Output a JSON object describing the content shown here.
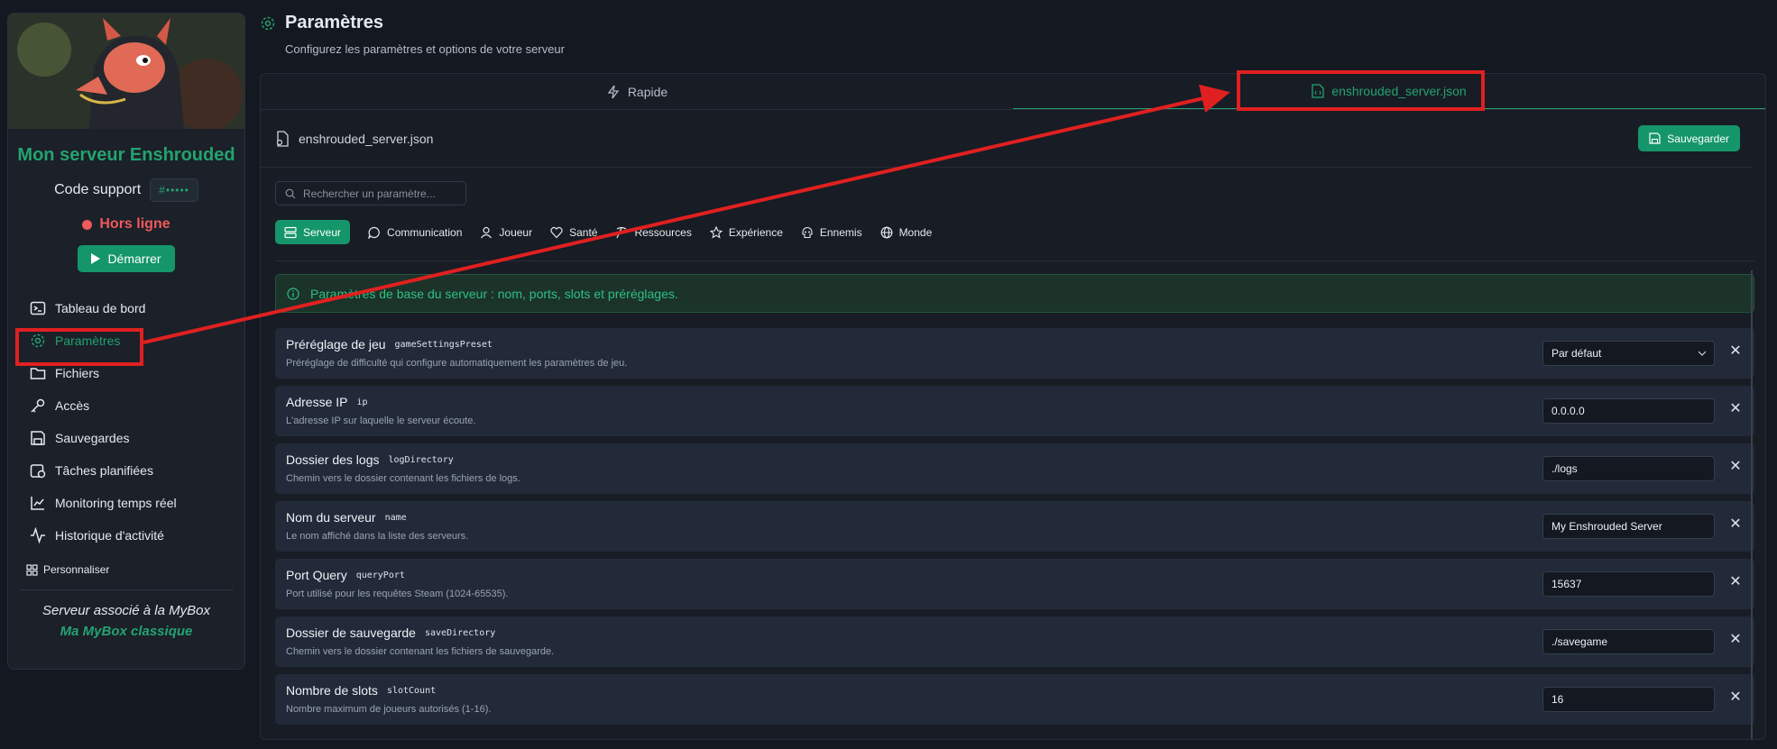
{
  "sidebar": {
    "server_name": "Mon serveur Enshrouded",
    "support_label": "Code support",
    "support_code": "#•••••",
    "status": "Hors ligne",
    "start_label": "Démarrer",
    "nav": [
      {
        "label": "Tableau de bord",
        "icon": "terminal-icon"
      },
      {
        "label": "Paramètres",
        "icon": "gear-icon",
        "active": true
      },
      {
        "label": "Fichiers",
        "icon": "folder-icon"
      },
      {
        "label": "Accès",
        "icon": "key-icon"
      },
      {
        "label": "Sauvegardes",
        "icon": "floppy-icon"
      },
      {
        "label": "Tâches planifiées",
        "icon": "calendar-clock-icon"
      },
      {
        "label": "Monitoring temps réel",
        "icon": "chart-line-icon"
      },
      {
        "label": "Historique d'activité",
        "icon": "activity-icon"
      }
    ],
    "personalize_label": "Personnaliser",
    "mybox_label": "Serveur associé à la MyBox",
    "mybox_name": "Ma MyBox classique"
  },
  "header": {
    "title": "Paramètres",
    "subtitle": "Configurez les paramètres et options de votre serveur"
  },
  "tabs": [
    {
      "label": "Rapide",
      "icon": "zap-icon"
    },
    {
      "label": "enshrouded_server.json",
      "icon": "file-code-icon",
      "active": true
    }
  ],
  "file": {
    "name": "enshrouded_server.json",
    "save_label": "Sauvegarder"
  },
  "search": {
    "placeholder": "Rechercher un paramètre..."
  },
  "categories": [
    {
      "label": "Serveur",
      "icon": "server-icon",
      "active": true
    },
    {
      "label": "Communication",
      "icon": "chat-icon"
    },
    {
      "label": "Joueur",
      "icon": "user-icon"
    },
    {
      "label": "Santé",
      "icon": "heart-icon"
    },
    {
      "label": "Ressources",
      "icon": "pickaxe-icon"
    },
    {
      "label": "Expérience",
      "icon": "star-icon"
    },
    {
      "label": "Ennemis",
      "icon": "skull-icon"
    },
    {
      "label": "Monde",
      "icon": "globe-icon"
    }
  ],
  "info": "Paramètres de base du serveur : nom, ports, slots et préréglages.",
  "settings": [
    {
      "title": "Préréglage de jeu",
      "key": "gameSettingsPreset",
      "desc": "Préréglage de difficulté qui configure automatiquement les paramètres de jeu.",
      "value": "Par défaut",
      "type": "select"
    },
    {
      "title": "Adresse IP",
      "key": "ip",
      "desc": "L'adresse IP sur laquelle le serveur écoute.",
      "value": "0.0.0.0"
    },
    {
      "title": "Dossier des logs",
      "key": "logDirectory",
      "desc": "Chemin vers le dossier contenant les fichiers de logs.",
      "value": "./logs"
    },
    {
      "title": "Nom du serveur",
      "key": "name",
      "desc": "Le nom affiché dans la liste des serveurs.",
      "value": "My Enshrouded Server"
    },
    {
      "title": "Port Query",
      "key": "queryPort",
      "desc": "Port utilisé pour les requêtes Steam (1024-65535).",
      "value": "15637"
    },
    {
      "title": "Dossier de sauvegarde",
      "key": "saveDirectory",
      "desc": "Chemin vers le dossier contenant les fichiers de sauvegarde.",
      "value": "./savegame"
    },
    {
      "title": "Nombre de slots",
      "key": "slotCount",
      "desc": "Nombre maximum de joueurs autorisés (1-16).",
      "value": "16"
    }
  ],
  "colors": {
    "accent": "#23a36f",
    "danger": "#ef5a5a",
    "annotation": "#e02020"
  }
}
